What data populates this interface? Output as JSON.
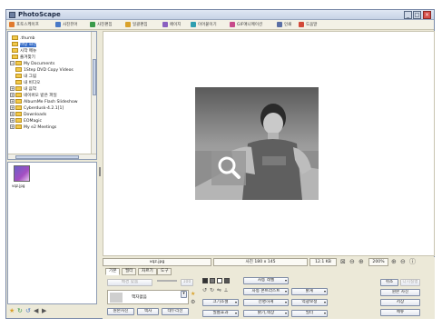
{
  "window": {
    "title": "PhotoScape"
  },
  "tabs": [
    {
      "label": "포토스케이프",
      "color": "#e07a2e"
    },
    {
      "label": "사진뷰어",
      "color": "#4a7ac7"
    },
    {
      "label": "사진편집",
      "color": "#3a9a4a"
    },
    {
      "label": "일괄편집",
      "color": "#d9a22b"
    },
    {
      "label": "페이지",
      "color": "#8a5fc0"
    },
    {
      "label": "이어붙이기",
      "color": "#2f9fb0"
    },
    {
      "label": "GIF애니메이션",
      "color": "#c74a8a"
    },
    {
      "label": "인쇄",
      "color": "#5a6fa5"
    },
    {
      "label": "도움말",
      "color": "#d24a3a"
    }
  ],
  "tree": [
    {
      "label": ".thumb"
    },
    {
      "label": "바탕 화면",
      "selected": true
    },
    {
      "label": "시작 메뉴"
    },
    {
      "label": "즐겨찾기"
    },
    {
      "label": "My Documents"
    },
    {
      "label": "1Step DVD Copy Videos"
    },
    {
      "label": "내 그림"
    },
    {
      "label": "내 비디오"
    },
    {
      "label": "내 음악"
    },
    {
      "label": "네이버오 받은 파일"
    },
    {
      "label": "AlbumMe Flash Slideshow"
    },
    {
      "label": "Cyberdusk-4.2.1[1]"
    },
    {
      "label": "Downloads"
    },
    {
      "label": "EOMagic"
    },
    {
      "label": "My e2 Meetings"
    }
  ],
  "thumbnail": {
    "caption": "vqz.jpg"
  },
  "status": {
    "filename": "vqz.jpg",
    "dimensions": "사진 180 x 145",
    "filesize": "12.1 KB",
    "zoom": "200%"
  },
  "edit_tabs": [
    "기본",
    "필터",
    "자르기",
    "도구"
  ],
  "edit": {
    "auto_fit": "배경 맞춤",
    "frame_name": "액자없음",
    "btn_auto_level": "자동 레벨",
    "btn_auto_contrast": "자동 콘트라스트",
    "btn_bright": "밝게",
    "btn_resize": "크기조절",
    "btn_sharpen": "선명하게",
    "btn_color_fix": "역광보정",
    "btn_film": "필름효과",
    "btn_bright_color": "밝기,색상",
    "btn_filter": "필터",
    "btn_original": "원본사진",
    "btn_frame": "액자",
    "btn_frame_line": "테두리선",
    "btn_cancel": "취소",
    "btn_redo": "다시실행",
    "btn_revert": "원본 사진",
    "btn_save": "저장",
    "btn_menu": "메뉴"
  }
}
